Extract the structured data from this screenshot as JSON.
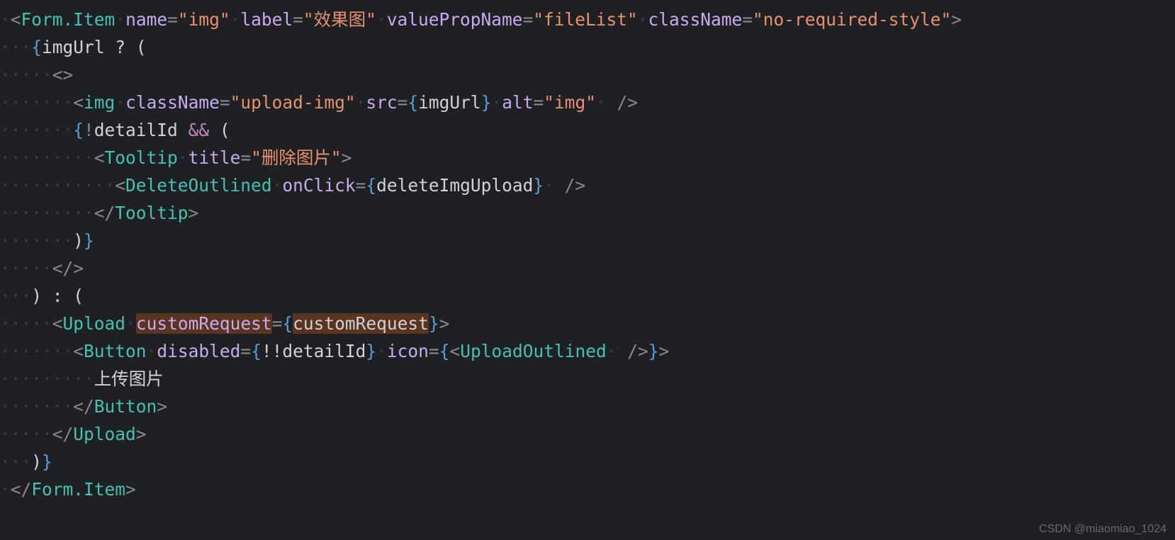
{
  "code": {
    "l1": {
      "open": "<",
      "tag": "Form.Item",
      "a1": "name",
      "v1": "\"img\"",
      "a2": "label",
      "v2": "\"效果图\"",
      "a3": "valuePropName",
      "v3": "\"fileList\"",
      "a4": "className",
      "v4": "\"no-required-style\"",
      "close": ">"
    },
    "l2": {
      "lb": "{",
      "id": "imgUrl",
      "q": " ? ("
    },
    "l3": {
      "frag": "<>"
    },
    "l4": {
      "open": "<",
      "tag": "img",
      "a1": "className",
      "v1": "\"upload-img\"",
      "a2": "src",
      "lb": "{",
      "jb": "imgUrl",
      "rb": "}",
      "a3": "alt",
      "v3": "\"img\"",
      "sc": " />"
    },
    "l5": {
      "lb": "{",
      "neg": "!",
      "id": "detailId",
      "and": " && ",
      "lp": "("
    },
    "l6": {
      "open": "<",
      "tag": "Tooltip",
      "a1": "title",
      "v1": "\"删除图片\"",
      "close": ">"
    },
    "l7": {
      "open": "<",
      "tag": "DeleteOutlined",
      "a1": "onClick",
      "lb": "{",
      "jb": "deleteImgUpload",
      "rb": "}",
      "sc": " />"
    },
    "l8": {
      "open": "</",
      "tag": "Tooltip",
      "close": ">"
    },
    "l9": {
      "rp": ")",
      "rb": "}"
    },
    "l10": {
      "frag": "</>"
    },
    "l11": {
      "txt": ") : ("
    },
    "l12": {
      "open": "<",
      "tag": "Upload",
      "a1": "customRequest",
      "lb": "{",
      "jb": "customRequest",
      "rb": "}",
      "close": ">"
    },
    "l13": {
      "open": "<",
      "tag": "Button",
      "a1": "disabled",
      "lb1": "{",
      "jb1": "!!detailId",
      "rb1": "}",
      "a2": "icon",
      "lb2": "{",
      "iopen": "<",
      "itag": "UploadOutlined",
      "isc": " />",
      "rb2": "}",
      "close": ">"
    },
    "l14": {
      "txt": "上传图片"
    },
    "l15": {
      "open": "</",
      "tag": "Button",
      "close": ">"
    },
    "l16": {
      "open": "</",
      "tag": "Upload",
      "close": ">"
    },
    "l17": {
      "rp": ")",
      "rb": "}"
    },
    "l18": {
      "open": "</",
      "tag": "Form.Item",
      "close": ">"
    }
  },
  "watermark": "CSDN @miaomiao_1024"
}
